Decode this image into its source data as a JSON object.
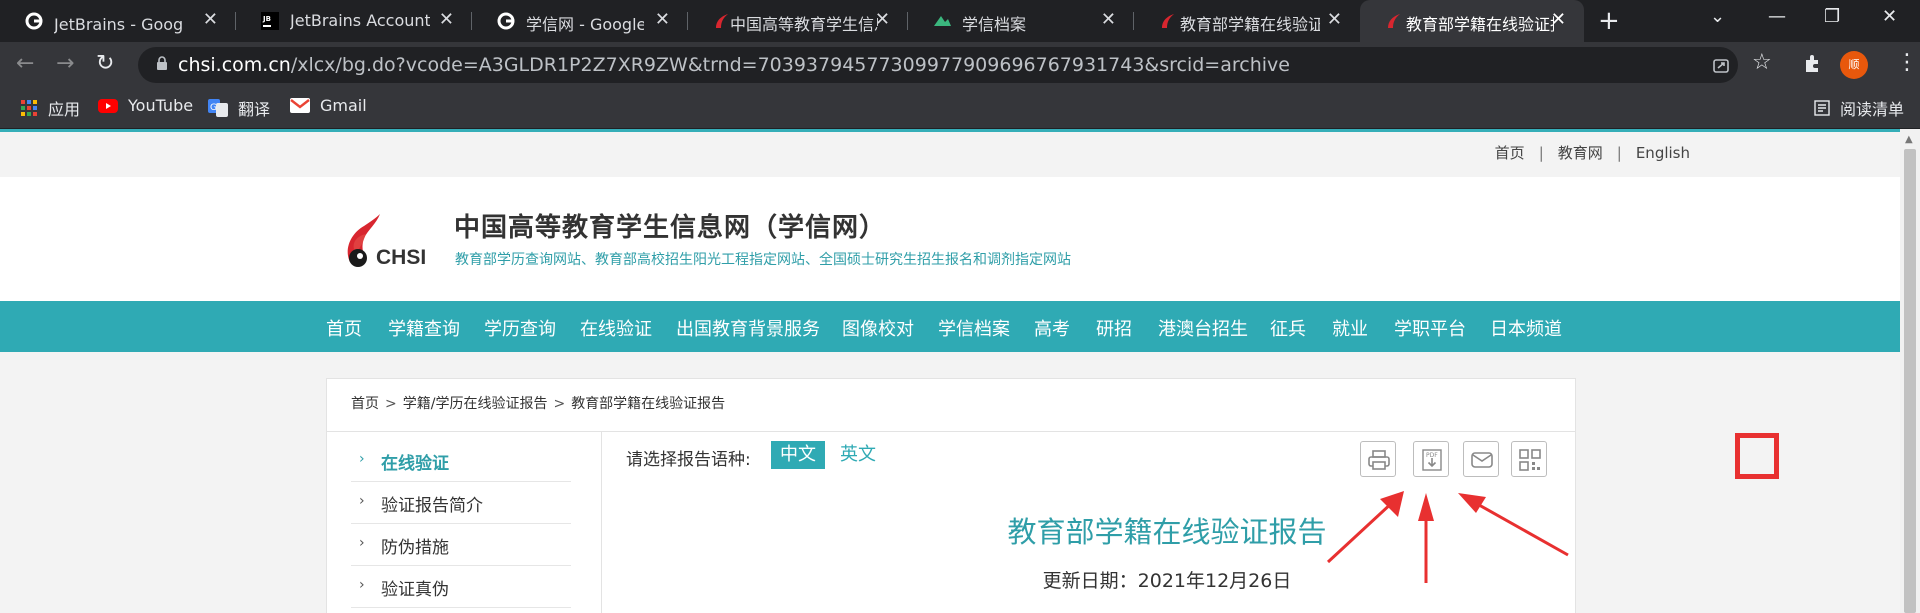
{
  "browser": {
    "tabs": [
      {
        "title": "JetBrains - Google 搜",
        "icon": "google-icon",
        "active": false
      },
      {
        "title": "JetBrains Account",
        "icon": "jetbrains-icon",
        "active": false
      },
      {
        "title": "学信网 - Google 搜索",
        "icon": "google-icon",
        "active": false
      },
      {
        "title": "中国高等教育学生信息",
        "icon": "chsi-icon",
        "active": false
      },
      {
        "title": "学信档案",
        "icon": "archive-icon",
        "active": false
      },
      {
        "title": "教育部学籍在线验证报",
        "icon": "chsi-icon",
        "active": false
      },
      {
        "title": "教育部学籍在线验证报",
        "icon": "chsi-icon",
        "active": true
      }
    ],
    "url_host": "chsi.com.cn",
    "url_path": "/xlcx/bg.do?vcode=A3GLDR1P2Z7XR9ZW&trnd=70393794577309977909696767931743&srcid=archive",
    "profile_initial": "顺",
    "bookmarks": [
      {
        "label": "应用",
        "icon": "apps-grid-icon"
      },
      {
        "label": "YouTube",
        "icon": "youtube-icon"
      },
      {
        "label": "翻译",
        "icon": "translate-icon"
      },
      {
        "label": "Gmail",
        "icon": "gmail-icon"
      }
    ],
    "reading_list": "阅读清单"
  },
  "page": {
    "toplinks": [
      "首页",
      "教育网",
      "English"
    ],
    "site_title": "中国高等教育学生信息网（学信网）",
    "site_slogan": "教育部学历查询网站、教育部高校招生阳光工程指定网站、全国硕士研究生招生报名和调剂指定网站",
    "logo_text": "CHSI",
    "nav": [
      "首页",
      "学籍查询",
      "学历查询",
      "在线验证",
      "出国教育背景服务",
      "图像校对",
      "学信档案",
      "高考",
      "研招",
      "港澳台招生",
      "征兵",
      "就业",
      "学职平台",
      "日本频道"
    ],
    "breadcrumb": [
      "首页",
      "学籍/学历在线验证报告",
      "教育部学籍在线验证报告"
    ],
    "sidebar": [
      "在线验证",
      "验证报告简介",
      "防伪措施",
      "验证真伪"
    ],
    "lang_label": "请选择报告语种:",
    "lang_options": [
      "中文",
      "英文"
    ],
    "tools": [
      {
        "name": "print-button",
        "icon": "printer-icon"
      },
      {
        "name": "pdf-download-button",
        "icon": "pdf-download-icon"
      },
      {
        "name": "email-button",
        "icon": "mail-icon"
      },
      {
        "name": "qrcode-button",
        "icon": "qrcode-icon"
      }
    ],
    "report_title": "教育部学籍在线验证报告",
    "report_date": "更新日期：2021年12月26日"
  },
  "colors": {
    "accent": "#2faab4",
    "highlight": "#e83030"
  }
}
